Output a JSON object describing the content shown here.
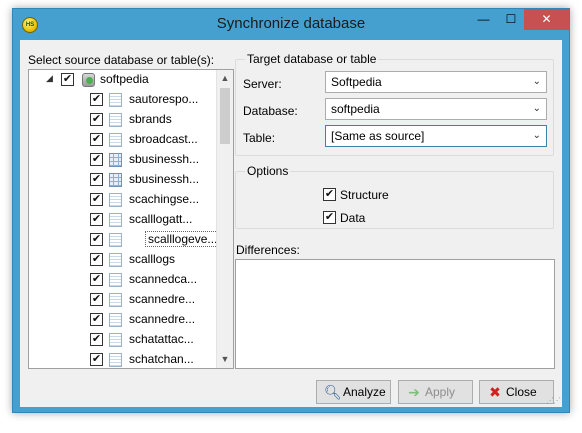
{
  "window": {
    "title": "Synchronize database",
    "icon_text": "HS",
    "controls": {
      "minimize": "—",
      "maximize": "☐",
      "close": "✕"
    }
  },
  "source": {
    "label": "Select source database or table(s):",
    "root": {
      "label": "softpedia",
      "checked": true,
      "expanded": true,
      "icon": "database-icon"
    },
    "items": [
      {
        "label": "sautorespo...",
        "checked": true,
        "icon": "table-icon"
      },
      {
        "label": "sbrands",
        "checked": true,
        "icon": "table-icon"
      },
      {
        "label": "sbroadcast...",
        "checked": true,
        "icon": "table-icon"
      },
      {
        "label": "sbusinessh...",
        "checked": true,
        "icon": "grid-table-icon"
      },
      {
        "label": "sbusinessh...",
        "checked": true,
        "icon": "grid-table-icon"
      },
      {
        "label": "scachingse...",
        "checked": true,
        "icon": "table-icon"
      },
      {
        "label": "scalllogatt...",
        "checked": true,
        "icon": "table-icon"
      },
      {
        "label": "scalllogeve...",
        "checked": true,
        "icon": "table-icon",
        "selected": true
      },
      {
        "label": "scalllogs",
        "checked": true,
        "icon": "table-icon"
      },
      {
        "label": "scannedca...",
        "checked": true,
        "icon": "table-icon"
      },
      {
        "label": "scannedre...",
        "checked": true,
        "icon": "table-icon"
      },
      {
        "label": "scannedre...",
        "checked": true,
        "icon": "table-icon"
      },
      {
        "label": "schatattac...",
        "checked": true,
        "icon": "table-icon"
      },
      {
        "label": "schatchan...",
        "checked": true,
        "icon": "table-icon"
      }
    ]
  },
  "target": {
    "group_title": "Target database or table",
    "server": {
      "label": "Server:",
      "value": "Softpedia"
    },
    "database": {
      "label": "Database:",
      "value": "softpedia"
    },
    "table": {
      "label": "Table:",
      "value": "[Same as source]"
    }
  },
  "options": {
    "group_title": "Options",
    "structure": {
      "label": "Structure",
      "checked": true
    },
    "data": {
      "label": "Data",
      "checked": true
    }
  },
  "differences": {
    "label": "Differences:"
  },
  "buttons": {
    "analyze": {
      "label": "Analyze",
      "icon": "magnifier-icon"
    },
    "apply": {
      "label": "Apply",
      "icon": "arrow-right-icon",
      "disabled": true
    },
    "close": {
      "label": "Close",
      "icon": "close-icon"
    }
  },
  "colors": {
    "titlebar": "#45a0cf",
    "close_button": "#c75050",
    "focus_border": "#3c7fb1"
  }
}
